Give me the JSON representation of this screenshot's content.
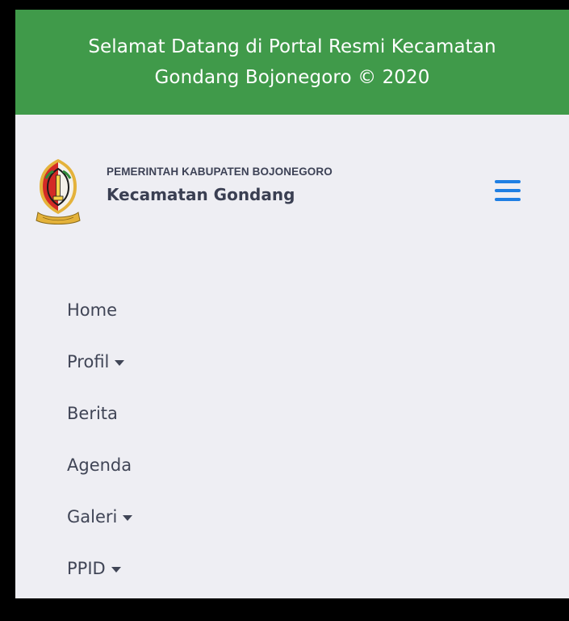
{
  "topbar": {
    "welcome_text": "Selamat Datang di Portal Resmi Kecamatan Gondang Bojonegoro © 2020"
  },
  "brand": {
    "logo_icon": "bojonegoro-regency-emblem-icon",
    "subtitle": "PEMERINTAH KABUPATEN BOJONEGORO",
    "title": "Kecamatan Gondang"
  },
  "menu_toggle_icon": "hamburger-menu-icon",
  "nav": {
    "items": [
      {
        "label": "Home",
        "has_dropdown": false
      },
      {
        "label": "Profil",
        "has_dropdown": true
      },
      {
        "label": "Berita",
        "has_dropdown": false
      },
      {
        "label": "Agenda",
        "has_dropdown": false
      },
      {
        "label": "Galeri",
        "has_dropdown": true
      },
      {
        "label": "PPID",
        "has_dropdown": true
      }
    ],
    "dropdown_icon": "caret-down-icon"
  },
  "colors": {
    "topbar_bg": "#409a4a",
    "page_bg": "#eeeef3",
    "accent_blue": "#1f7fe3",
    "text_dark": "#404556"
  }
}
